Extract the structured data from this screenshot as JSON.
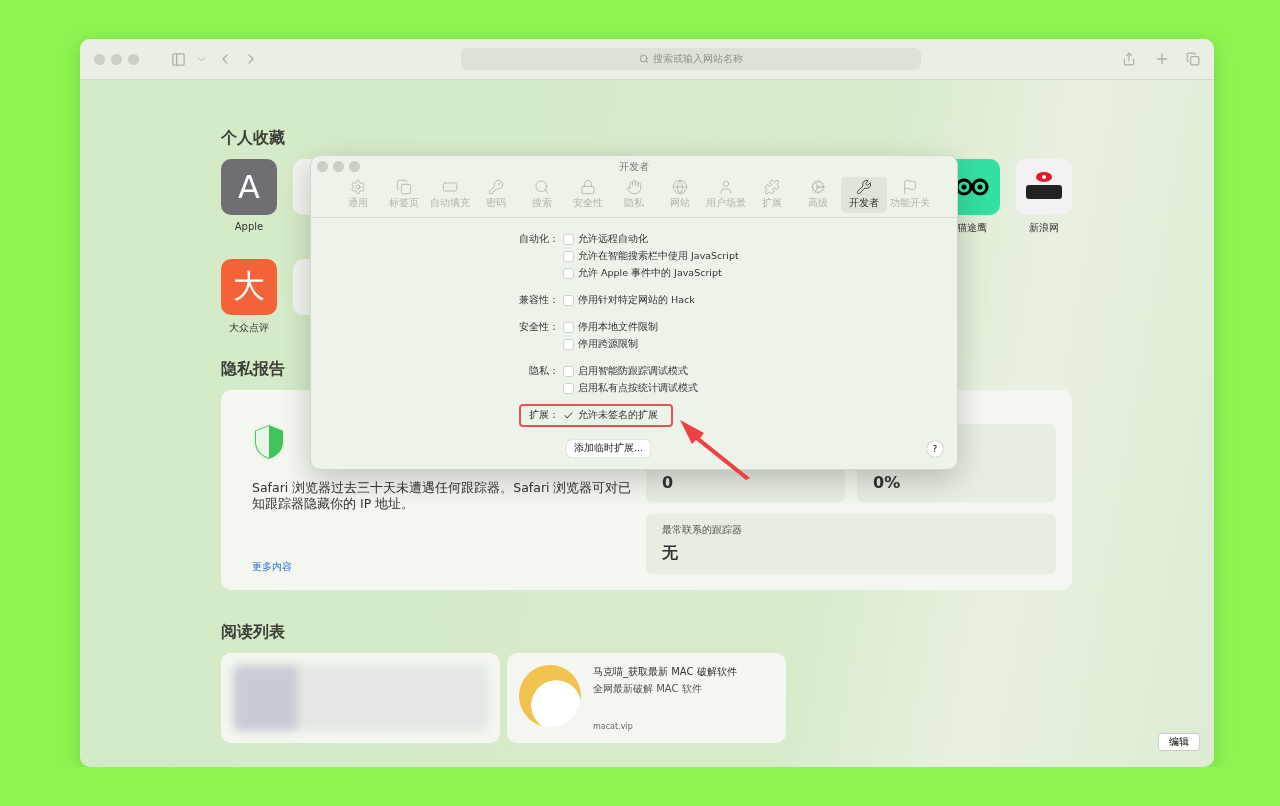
{
  "browser": {
    "address_placeholder": "搜索或输入网站名称"
  },
  "favorites": {
    "title": "个人收藏",
    "rows": [
      {
        "left": [
          {
            "kind": "letter",
            "glyph": "A",
            "color": "#6e6e73",
            "label": "Apple"
          },
          {
            "kind": "blank"
          }
        ],
        "right": [
          {
            "kind": "owl",
            "color": "#34e0a1",
            "label": "猫途鹰"
          },
          {
            "kind": "sina",
            "color": "#f2f2f2",
            "label": "新浪网"
          }
        ]
      },
      {
        "left": [
          {
            "kind": "letter",
            "glyph": "大",
            "color": "#f4623a",
            "label": "大众点评"
          },
          {
            "kind": "blank"
          }
        ],
        "right": []
      }
    ]
  },
  "privacy": {
    "title": "隐私报告",
    "description": "Safari 浏览器过去三十天未遭遇任何跟踪器。Safari 浏览器可对已知跟踪器隐藏你的 IP 地址。",
    "link": "更多内容",
    "stats": [
      {
        "value": "0"
      },
      {
        "value": "0%"
      },
      {
        "label": "最常联系的跟踪器",
        "value": "无"
      }
    ]
  },
  "reading_list": {
    "title": "阅读列表",
    "items": [
      {
        "kind": "blurred"
      },
      {
        "kind": "article",
        "title": "马克喵_获取最新 MAC 破解软件",
        "subtitle": "全网最新破解 MAC 软件",
        "url": "macat.vip"
      }
    ],
    "edit_button": "编辑"
  },
  "dialog": {
    "title": "开发者",
    "tabs": [
      {
        "label": "通用",
        "selected": false
      },
      {
        "label": "标签页",
        "selected": false
      },
      {
        "label": "自动填充",
        "selected": false
      },
      {
        "label": "密码",
        "selected": false
      },
      {
        "label": "搜索",
        "selected": false
      },
      {
        "label": "安全性",
        "selected": false
      },
      {
        "label": "隐私",
        "selected": false
      },
      {
        "label": "网站",
        "selected": false
      },
      {
        "label": "用户场景",
        "selected": false
      },
      {
        "label": "扩展",
        "selected": false
      },
      {
        "label": "高级",
        "selected": false
      },
      {
        "label": "开发者",
        "selected": true
      },
      {
        "label": "功能开关",
        "selected": false
      }
    ],
    "sections": [
      {
        "label": "自动化：",
        "options": [
          {
            "text": "允许远程自动化",
            "checked": false
          },
          {
            "text": "允许在智能搜索栏中使用 JavaScript",
            "checked": false
          },
          {
            "text": "允许 Apple 事件中的 JavaScript",
            "checked": false
          }
        ]
      },
      {
        "label": "兼容性：",
        "options": [
          {
            "text": "停用针对特定网站的 Hack",
            "checked": false
          }
        ]
      },
      {
        "label": "安全性：",
        "options": [
          {
            "text": "停用本地文件限制",
            "checked": false
          },
          {
            "text": "停用跨源限制",
            "checked": false
          }
        ]
      },
      {
        "label": "隐私：",
        "options": [
          {
            "text": "启用智能防跟踪调试模式",
            "checked": false
          },
          {
            "text": "启用私有点按统计调试模式",
            "checked": false
          }
        ]
      },
      {
        "label": "扩展：",
        "highlighted": true,
        "options": [
          {
            "text": "允许未签名的扩展",
            "checked": true
          }
        ]
      }
    ],
    "add_button": "添加临时扩展...",
    "help": "?"
  }
}
